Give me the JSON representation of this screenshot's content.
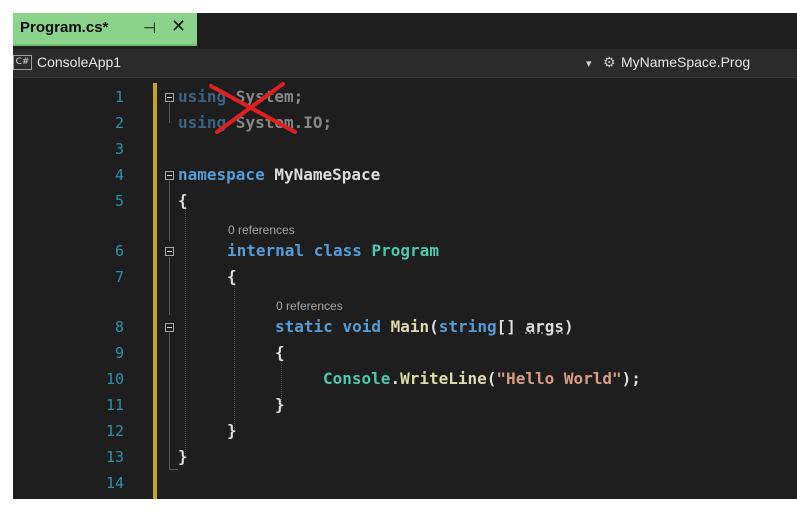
{
  "tab": {
    "title": "Program.cs*",
    "pin": "⊣",
    "close": "✕"
  },
  "navbar": {
    "cs_badge": "C#",
    "project": "ConsoleApp1",
    "dropdown": "▾",
    "member_icon": "⚙",
    "member": "MyNameSpace.Prog"
  },
  "line_numbers": [
    "1",
    "2",
    "3",
    "4",
    "5",
    "6",
    "7",
    "8",
    "9",
    "10",
    "11",
    "12",
    "13",
    "14"
  ],
  "code": {
    "l1": {
      "kw": "using",
      "rest": " System;"
    },
    "l2": {
      "kw": "using",
      "rest": " System.IO;"
    },
    "l4": {
      "kw": "namespace",
      "rest": " MyNameSpace"
    },
    "l5": "{",
    "refs1": "0 references",
    "l6": {
      "kw1": "internal",
      "kw2": "class",
      "cls": "Program"
    },
    "l7": "{",
    "refs2": "0 references",
    "l8": {
      "kw1": "static",
      "kw2": "void",
      "mth": "Main",
      "p1": "(",
      "kw3": "string",
      "p2": "[] ",
      "args": "args",
      "p3": ")"
    },
    "l9": "{",
    "l10": {
      "cls": "Console",
      "dot": ".",
      "mth": "WriteLine",
      "p1": "(",
      "str": "\"Hello World\"",
      "p2": ");"
    },
    "l11": "}",
    "l12": "}",
    "l13": "}"
  },
  "colors": {
    "keyword": "#569cd6",
    "type": "#4ec9b0",
    "method": "#dcdcaa",
    "string": "#d69d85",
    "line_number": "#2b91af",
    "strike": "#e02020",
    "tab": "#8bd28b"
  }
}
